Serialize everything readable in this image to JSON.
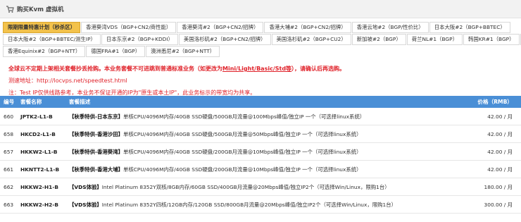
{
  "header": {
    "title": "购买Kvm 虚拟机"
  },
  "tabs": [
    [
      "限期限量特惠计划（秒杀区）",
      "香港葵湾VDS（BGP+CN2/商性能）",
      "香港葵湾#2（BGP+CN2/招牌）",
      "香港大埔#2（BGP+CN2/招牌）",
      "香港云地#2（BGP/性价比）",
      "日本大阪#2（BGP+BBTEC）"
    ],
    [
      "日本大阪#2（BGP+BBTEC/测生IP）",
      "日本东京#2（BGP+KDDI）",
      "美国洛杉矶#2（BGP+CN2/招牌）",
      "美国洛杉矶#2（BGP+CU2）",
      "新加坡#2（BGP）",
      "荷兰NL#1（BGP）",
      "韩国KR#1（BGP）",
      "德"
    ],
    [
      "香港Equinix#2（BGP+NTT）",
      "德国FRA#1（BGP）",
      "澳洲悉尼#2（BGP+NTT）"
    ]
  ],
  "notice": {
    "line1_pre": "全球云不定期上架相关套餐抄丢抢购。本业务套餐不可进跳到普通标准业务（如更改为",
    "line1_link": "Mini/Light/Basic/Std等",
    "line1_post": "），请确认后再选购。",
    "line2": "测速地址：http://locvps.net/speedtest.html",
    "line3": "注：Test IP仅供线路参考，本业务不保证开通的IP为\"原生或本土IP\"，此业务标示的带宽均为共享。"
  },
  "table": {
    "headers": {
      "id": "编号",
      "name": "套餐名称",
      "desc": "套餐描述",
      "price": "价格（RMB）"
    },
    "rows": [
      {
        "id": "660",
        "name": "JPTK2-L1-B",
        "tag": "【秋季特供-日本东京】",
        "desc": "单核CPU/4096M内存/40GB SSD硬盘/500GB月流量@100Mbps峰值/独立IP 一个（可选择linux系统）",
        "price": "42.00 / 月"
      },
      {
        "id": "658",
        "name": "HKCD2-L1-B",
        "tag": "【秋季特供-香港沙田】",
        "desc": "单核CPU/4096M内存/40GB SSD硬盘/500GB月流量@50Mbps峰值/独立IP 一个（可选择linux系统）",
        "price": "42.00 / 月"
      },
      {
        "id": "657",
        "name": "HKKW2-L1-B",
        "tag": "【秋季特供-香港葵湾】",
        "desc": "单核CPU/4096M内存/40GB SSD硬盘/200GB月流量@10Mbps峰值/独立IP 一个（可选择linux系统）",
        "price": "42.00 / 月"
      },
      {
        "id": "661",
        "name": "HKNTT2-L1-B",
        "tag": "【秋季特供-香港大埔】",
        "desc": "单核CPU/4096M内存/40GB SSD硬盘/200GB月流量@10Mbps峰值/独立IP 一个（可选择linux系统）",
        "price": "42.00 / 月"
      },
      {
        "id": "662",
        "name": "HKKW2-H1-B",
        "tag": "【VDS体验】",
        "desc": "Intel Platinum 8352Y双核/8GB内存/60GB SSD/400GB月流量@20Mbps峰值/独立IP2个（可选择Win/Linux，限购1台）",
        "price": "180.00 / 月"
      },
      {
        "id": "663",
        "name": "HKKW2-H2-B",
        "tag": "【VDS体验】",
        "desc": "Intel Platinum 8352Y四核/12GB内存/120GB SSD/800GB月流量@20Mbps峰值/独立IP2个（可选择Win/Linux，限购1台）",
        "price": "300.00 / 月"
      }
    ]
  },
  "colors": {
    "active_tab": "#f3c24b",
    "table_header": "#4a8fd6",
    "notice": "#e0222a"
  },
  "icons": {
    "title": "cart-icon"
  }
}
